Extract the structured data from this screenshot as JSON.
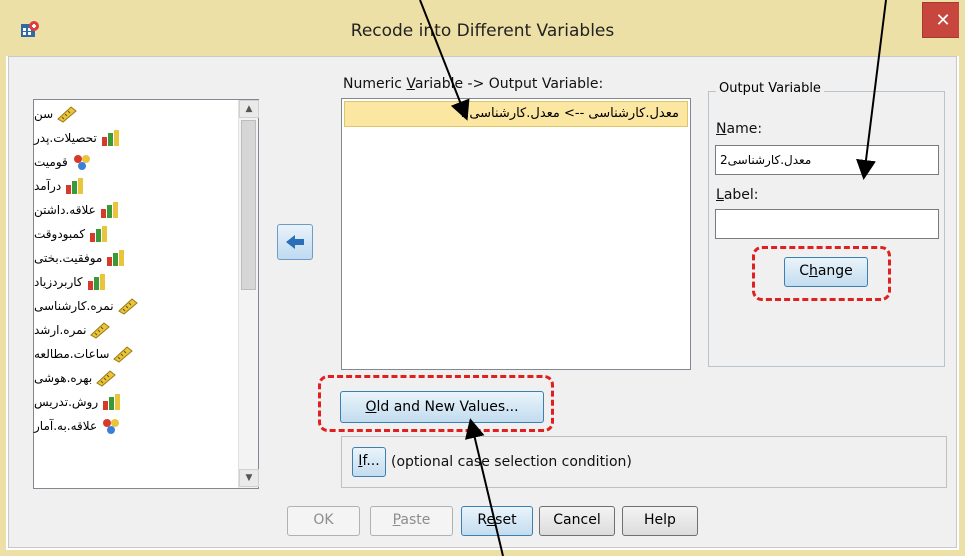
{
  "window": {
    "title": "Recode into Different Variables",
    "close_glyph": "✕"
  },
  "variables": [
    {
      "label": "سن",
      "icon": "ruler-icon"
    },
    {
      "label": "تحصیلات.پدر",
      "icon": "bar-chart-icon"
    },
    {
      "label": "قومیت",
      "icon": "nominal-icon"
    },
    {
      "label": "درآمد",
      "icon": "bar-chart-icon"
    },
    {
      "label": "علاقه.داشتن",
      "icon": "bar-chart-icon"
    },
    {
      "label": "کمبودوقت",
      "icon": "bar-chart-icon"
    },
    {
      "label": "موفقیت.بختی",
      "icon": "bar-chart-icon"
    },
    {
      "label": "کاربردزیاد",
      "icon": "bar-chart-icon"
    },
    {
      "label": "نمره.کارشناسی",
      "icon": "ruler-icon"
    },
    {
      "label": "نمره.ارشد",
      "icon": "ruler-icon"
    },
    {
      "label": "ساعات.مطالعه",
      "icon": "ruler-icon"
    },
    {
      "label": "بهره.هوشی",
      "icon": "ruler-icon"
    },
    {
      "label": "روش.تدریس",
      "icon": "bar-chart-icon"
    },
    {
      "label": "علاقه.به.آمار",
      "icon": "nominal-icon"
    }
  ],
  "mapping": {
    "header_pre": "Numeric ",
    "header_ul": "V",
    "header_post": "ariable -> Output Variable:",
    "row": "معدل.کارشناسی --> معدل.کارشناسی2"
  },
  "output": {
    "title": "Output Variable",
    "name_label_ul": "N",
    "name_label_rest": "ame:",
    "name_value": "معدل.کارشناسی2",
    "label_label_ul": "L",
    "label_label_rest": "abel:",
    "label_value": "",
    "change_pre": "C",
    "change_ul": "h",
    "change_post": "ange"
  },
  "buttons": {
    "old_new_ul": "O",
    "old_new_rest": "ld and New Values...",
    "if_ul": "I",
    "if_rest": "f...",
    "if_note": "(optional case selection condition)",
    "ok": "OK",
    "paste_ul": "P",
    "paste_rest": "aste",
    "reset_pre": "R",
    "reset_ul": "e",
    "reset_post": "set",
    "cancel": "Cancel",
    "help": "Help"
  },
  "colors": {
    "title_bar": "#ede0a6",
    "selected_row": "#fbe6a2",
    "highlight_dash": "#e0201f",
    "close_button": "#c7463d"
  }
}
